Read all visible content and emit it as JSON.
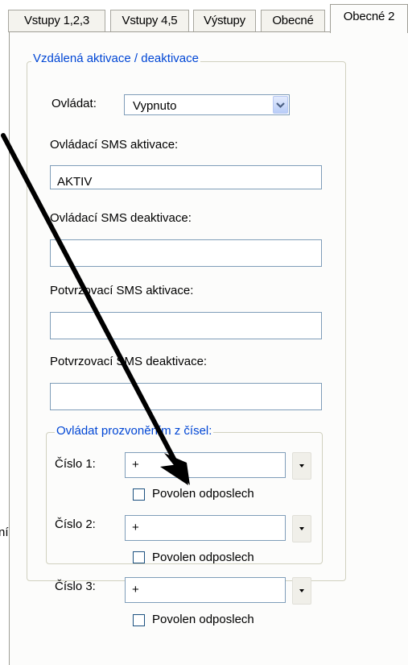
{
  "tabs": [
    "Vstupy 1,2,3",
    "Vstupy 4,5",
    "Výstupy",
    "Obecné",
    "Obecné 2"
  ],
  "remote_group": {
    "title": "Vzdálená aktivace / deaktivace",
    "control_label": "Ovládat:",
    "control_value": "Vypnuto",
    "sms_activation_label": "Ovládací SMS aktivace:",
    "sms_activation_value": "AKTIV",
    "sms_deactivation_label": "Ovládací SMS deaktivace:",
    "sms_deactivation_value": "",
    "confirm_activation_label": "Potvrzovací SMS aktivace:",
    "confirm_activation_value": "",
    "confirm_deactivation_label": "Potvrzovací SMS deaktivace:",
    "confirm_deactivation_value": ""
  },
  "ring_group": {
    "title": "Ovládat prozvoněním z čísel:",
    "numbers": [
      {
        "label": "Číslo 1:",
        "value": "+",
        "checkbox_label": "Povolen odposlech"
      },
      {
        "label": "Číslo 2:",
        "value": "+",
        "checkbox_label": "Povolen odposlech"
      },
      {
        "label": "Číslo 3:",
        "value": "+",
        "checkbox_label": "Povolen odposlech"
      }
    ]
  },
  "left_fragment": "ní",
  "icons": {
    "dropdown": "chevron-down-icon",
    "small_dropdown": "triangle-down-icon",
    "annotation": "arrow-annotation"
  }
}
